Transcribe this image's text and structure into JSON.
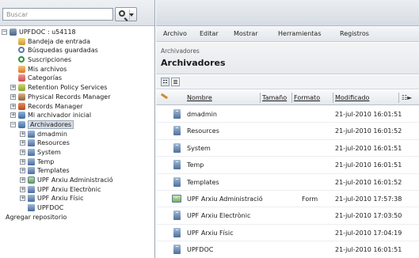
{
  "search": {
    "placeholder": "Buscar"
  },
  "tree": [
    {
      "name": "tree-root",
      "label": "UPFDOC : u54118",
      "icon": "root-icon",
      "level": 0,
      "expander": "−",
      "cls": "ic-root"
    },
    {
      "name": "tree-item-bandeja",
      "label": "Bandeja de entrada",
      "icon": "inbox-icon",
      "level": 1,
      "expander": "",
      "cls": "ic-inbox"
    },
    {
      "name": "tree-item-busquedas",
      "label": "Búsquedas guardadas",
      "icon": "saved-search-icon",
      "level": 1,
      "expander": "",
      "cls": "ic-search"
    },
    {
      "name": "tree-item-suscripciones",
      "label": "Suscripciones",
      "icon": "subscriptions-icon",
      "level": 1,
      "expander": "",
      "cls": "ic-subs"
    },
    {
      "name": "tree-item-mis-archivos",
      "label": "Mis archivos",
      "icon": "my-files-icon",
      "level": 1,
      "expander": "",
      "cls": "ic-myfiles"
    },
    {
      "name": "tree-item-categorias",
      "label": "Categorías",
      "icon": "categories-icon",
      "level": 1,
      "expander": "",
      "cls": "ic-cat"
    },
    {
      "name": "tree-item-retention",
      "label": "Retention Policy Services",
      "icon": "retention-icon",
      "level": 1,
      "expander": "+",
      "cls": "ic-retention"
    },
    {
      "name": "tree-item-physical",
      "label": "Physical Records Manager",
      "icon": "physical-records-icon",
      "level": 1,
      "expander": "+",
      "cls": "ic-physical"
    },
    {
      "name": "tree-item-records",
      "label": "Records Manager",
      "icon": "records-manager-icon",
      "level": 1,
      "expander": "+",
      "cls": "ic-records"
    },
    {
      "name": "tree-item-mi-archivador",
      "label": "Mi archivador inicial",
      "icon": "home-cabinet-icon",
      "level": 1,
      "expander": "+",
      "cls": "ic-archive"
    },
    {
      "name": "tree-item-archivadores",
      "label": "Archivadores",
      "icon": "cabinets-icon",
      "level": 1,
      "expander": "−",
      "cls": "ic-archive",
      "selected": true
    },
    {
      "name": "tree-item-dmadmin",
      "label": "dmadmin",
      "icon": "cabinet-icon",
      "level": 2,
      "expander": "+",
      "cls": "ic-cab"
    },
    {
      "name": "tree-item-resources",
      "label": "Resources",
      "icon": "cabinet-icon",
      "level": 2,
      "expander": "+",
      "cls": "ic-cab"
    },
    {
      "name": "tree-item-system",
      "label": "System",
      "icon": "cabinet-icon",
      "level": 2,
      "expander": "+",
      "cls": "ic-cab"
    },
    {
      "name": "tree-item-temp",
      "label": "Temp",
      "icon": "cabinet-icon",
      "level": 2,
      "expander": "+",
      "cls": "ic-cab"
    },
    {
      "name": "tree-item-templates",
      "label": "Templates",
      "icon": "cabinet-icon",
      "level": 2,
      "expander": "+",
      "cls": "ic-cab"
    },
    {
      "name": "tree-item-upf-administracio",
      "label": "UPF Arxiu Administració",
      "icon": "form-icon",
      "level": 2,
      "expander": "+",
      "cls": "ic-form"
    },
    {
      "name": "tree-item-upf-electronic",
      "label": "UPF Arxiu Electrònic",
      "icon": "cabinet-icon",
      "level": 2,
      "expander": "+",
      "cls": "ic-cab"
    },
    {
      "name": "tree-item-upf-fisic",
      "label": "UPF Arxiu Físic",
      "icon": "cabinet-icon",
      "level": 2,
      "expander": "+",
      "cls": "ic-cab"
    },
    {
      "name": "tree-item-upfdoc",
      "label": "UPFDOC",
      "icon": "cabinet-icon",
      "level": 2,
      "expander": "",
      "cls": "ic-cab"
    },
    {
      "name": "tree-item-agregar-repositorio",
      "label": "Agregar repositorio",
      "icon": "",
      "level": 0,
      "expander": "",
      "cls": ""
    }
  ],
  "menu": [
    "Archivo",
    "Editar",
    "Mostrar",
    "Herramientas",
    "Registros"
  ],
  "header": {
    "breadcrumb": "Archivadores",
    "title": "Archivadores"
  },
  "columns": {
    "nombre": "Nombre",
    "tamano": "Tamaño",
    "formato": "Formato",
    "modificado": "Modificado"
  },
  "files": [
    {
      "name": "dmadmin",
      "format": "",
      "modified": "21-jul-2010 16:01:51",
      "icon": "cabinet-icon"
    },
    {
      "name": "Resources",
      "format": "",
      "modified": "21-jul-2010 16:01:52",
      "icon": "cabinet-icon"
    },
    {
      "name": "System",
      "format": "",
      "modified": "21-jul-2010 16:01:51",
      "icon": "cabinet-icon"
    },
    {
      "name": "Temp",
      "format": "",
      "modified": "21-jul-2010 16:01:51",
      "icon": "cabinet-icon"
    },
    {
      "name": "Templates",
      "format": "",
      "modified": "21-jul-2010 16:01:52",
      "icon": "cabinet-icon"
    },
    {
      "name": "UPF Arxiu Administració",
      "format": "Form",
      "modified": "21-jul-2010 17:57:38",
      "icon": "form-icon"
    },
    {
      "name": "UPF Arxiu Electrònic",
      "format": "",
      "modified": "21-jul-2010 17:03:50",
      "icon": "cabinet-icon"
    },
    {
      "name": "UPF Arxiu Físic",
      "format": "",
      "modified": "21-jul-2010 17:04:19",
      "icon": "cabinet-icon"
    },
    {
      "name": "UPFDOC",
      "format": "",
      "modified": "21-jul-2010 16:01:51",
      "icon": "cabinet-icon"
    }
  ]
}
